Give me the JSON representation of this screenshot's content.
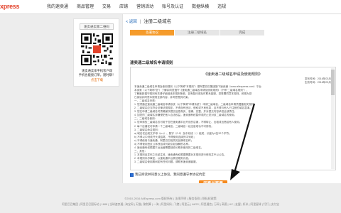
{
  "brand": {
    "logo_text": "xpress",
    "accent": "#f58a1f",
    "brand_red": "#e3422b"
  },
  "nav": {
    "items": [
      "我的速卖通",
      "商品管理",
      "交易",
      "店铺",
      "营销活动",
      "账号及认证",
      "数据纵横",
      "违规"
    ]
  },
  "sidebar": {
    "button_label": "速卖通卖家二维码",
    "qr_icon": "qr-code-icon",
    "caption_line1": "速卖通卖家手机客户端",
    "caption_line2": "手机也能接订单，随时聊！",
    "link": "点击下载"
  },
  "breadcrumb": {
    "back_label": "< 返回",
    "separator": "|",
    "title": "注册二级域名"
  },
  "steps": [
    "签署协议",
    "注册二级域名",
    "完成"
  ],
  "section_title": "速卖通二级域名申请规则",
  "agreement": {
    "title": "《速卖通二级域名申请及使用规则》",
    "meta_line1": "发布时间：2016年03月",
    "meta_line2": "生效时间：2016年03月",
    "body": [
      "本速卖通二级域名申请及使用规则（以下简称\"本规则\"）是阿里巴巴集团旗下速卖通（www.aliexpress.com）平台",
      "本卖家（以下简称\"您\"）了解并同意遵守《速卖通二级域名申请及使用规则》（下称\"二级域名规则\"），",
      "了解最新遵守规则有关请仔细阅读本规则条款，如有疑问请及时联系客服。您签署同意本规则，即视为您",
      "已阅读并同意本规则全部内容，并同意受其约束。",
      "一、二级域名申请：",
      "1. 您须通过速卖通二级域名申请系统（以下简称\"申请系统\"）申请二级域名，二级域名申请须遵循相关规则。",
      "2. 二级域名应当符合法律法规规定，不得含有违法、侵权或不良信息，且不得与他人已注册的域名混淆。",
      "3. 您在申请二级域名时须确保所提交信息真实、准确、完整，并对提交内容承担全部责任。",
      "4. 如您的二级域名涉嫌侵犯他人合法权益，速卖通有权暂停或终止您对该二级域名的使用。",
      "二、二级域名使用：",
      "1. 您申请的二级域名仅可用于您在速卖通平台开设的店铺，不得转让、出租或出借给他人使用。",
      "2. 每个店铺仅可申请一个二级域名，二级域名一经注册成功不可修改。",
      "3. 二级域名命名规则：",
      "a) 域名仅由英文字母（a-z）、数字（0-9）及中划线（-）组成，长度为4至32个字符；",
      "b) 不得以中划线开头或结尾，不得使用连续的中划线；",
      "c) 不得使用与速卖通、阿里巴巴相关的品牌或名称；",
      "d) 不得使用违反公序良俗或可能引起误解的名称。",
      "4. 速卖通有权根据平台运营需要回收长期未使用的二级域名。",
      "三、其他：",
      "1. 本规则自发布之日起生效，速卖通有权根据需要对本规则进行修改并予以公告。",
      "2. 本规则未尽事宜，以速卖通平台其他规则为准。",
      "3. 二级域名使用期间如有任何问题，请联系速卖通客服。"
    ]
  },
  "agree": {
    "label": "我已阅读并同意以上协议，我同意遵守本协议约定"
  },
  "submit_label": "同意并签署",
  "footer": {
    "copyright": "©2010-2016 AliExpress.com 版权所有 | 法律声明 | 服务条款 | 隐私权政策",
    "links": "阿里巴巴集团 | 阿里巴巴国际站 | 1688 | 全球速卖通 | 淘宝网 | 天猫 | 聚划算 | 一淘 | 阿里妈妈 | 飞猪 | 阿里云 | AliOS | 阿里通信 | 万网 | 高德 | UC | 友盟 | 虾米 | 阿里星球 | 钉钉 | 支付宝"
  }
}
